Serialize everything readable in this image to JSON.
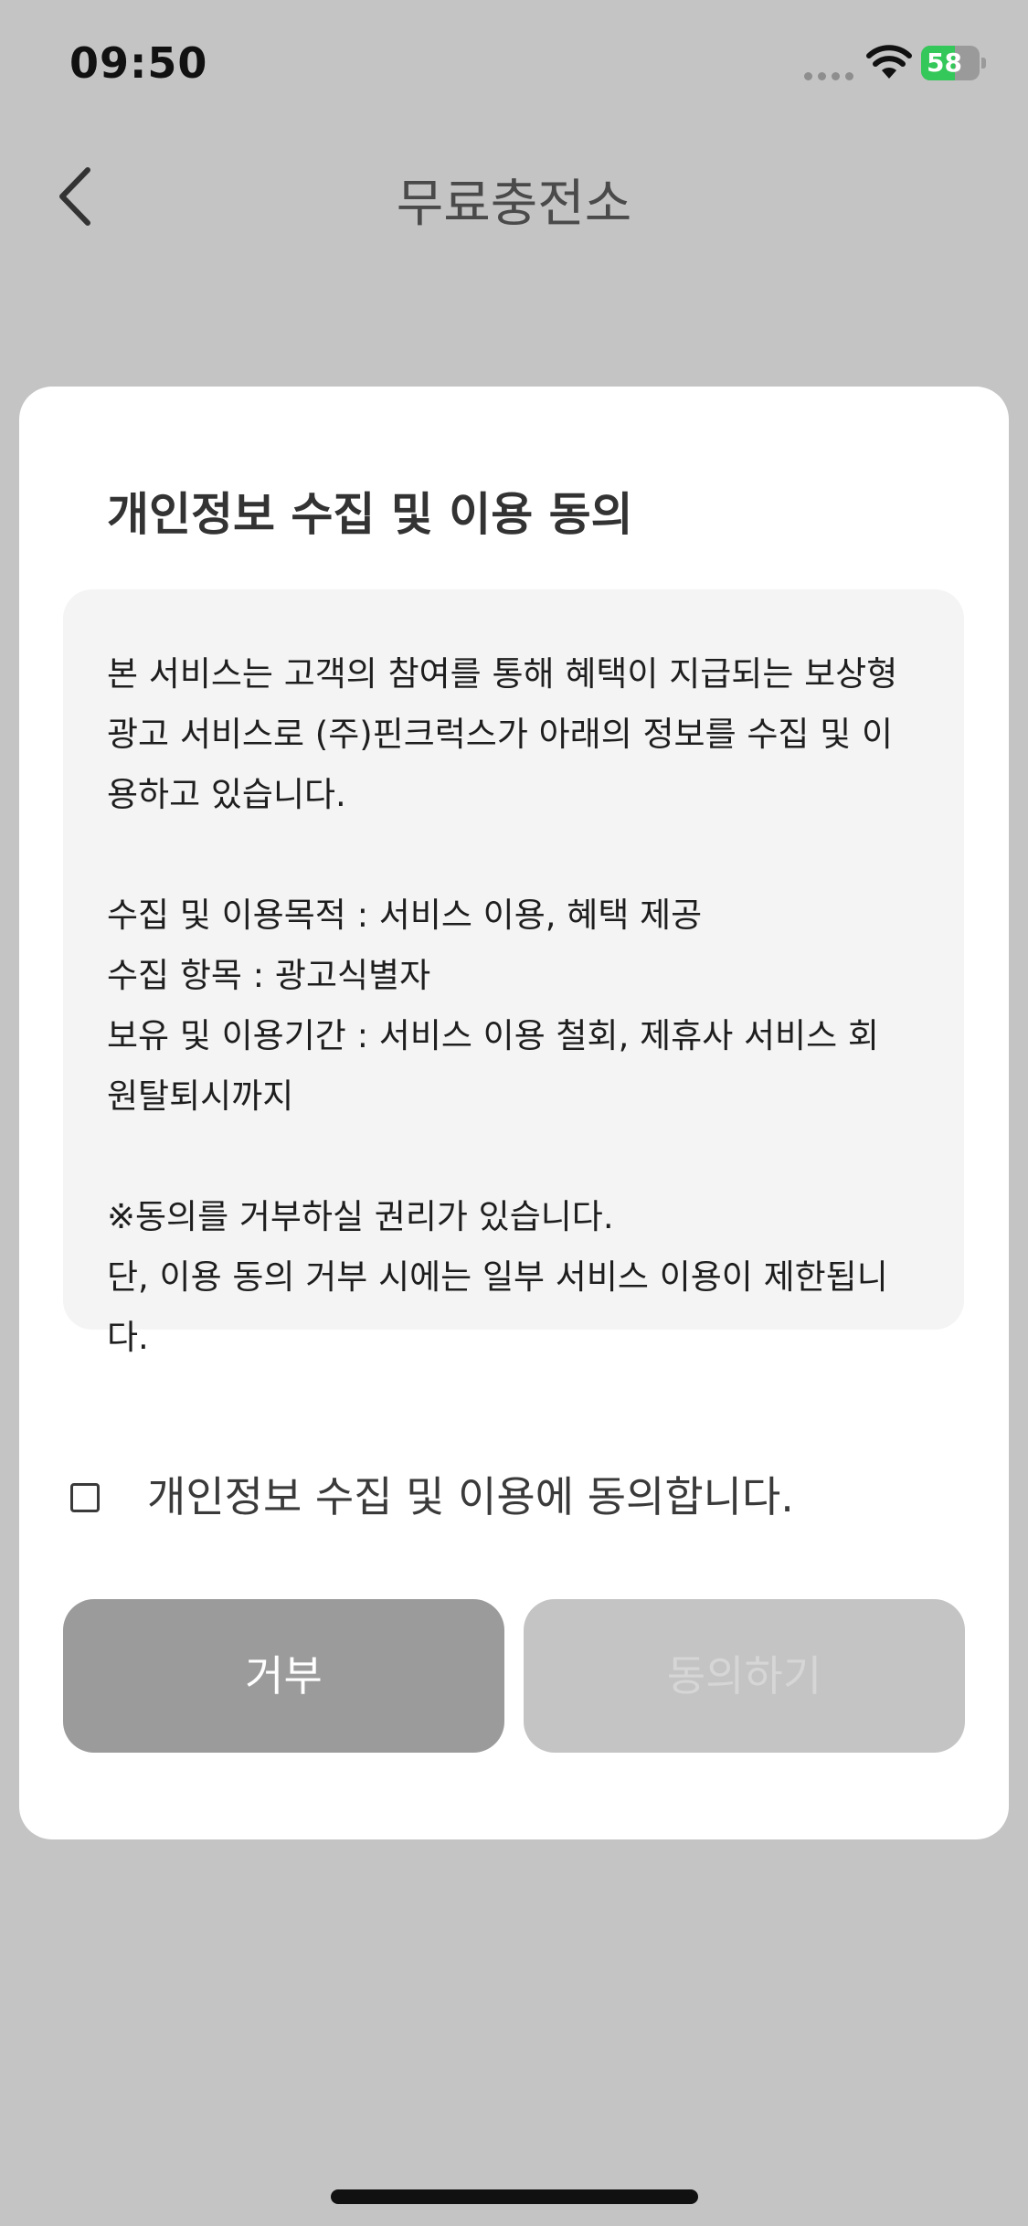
{
  "status_bar": {
    "time": "09:50",
    "battery_level": "58",
    "battery_fraction": 0.58
  },
  "nav": {
    "title": "무료충전소",
    "back_icon": "chevron-left-icon"
  },
  "dialog": {
    "title": "개인정보 수집 및 이용 동의",
    "terms_lines": [
      "본 서비스는 고객의 참여를 통해 혜택이 지급되는 보상형",
      "광고 서비스로 (주)핀크럭스가 아래의 정보를 수집 및 이",
      "용하고 있습니다.",
      "",
      "수집 및 이용목적 : 서비스 이용, 혜택 제공",
      "수집 항목 : 광고식별자",
      "보유 및 이용기간 : 서비스 이용 철회, 제휴사 서비스 회",
      "원탈퇴시까지",
      "",
      "※동의를 거부하실 권리가 있습니다.",
      "단, 이용 동의 거부 시에는 일부 서비스 이용이 제한됩니",
      "다."
    ],
    "agree_label": "개인정보 수집 및 이용에 동의합니다.",
    "agree_checked": false,
    "decline_button": "거부",
    "agree_button": "동의하기"
  },
  "colors": {
    "overlay": "#c4c4c4",
    "decline_bg": "#9b9b9b",
    "agree_disabled_bg": "#c4c4c4",
    "battery_green": "#34c759"
  }
}
